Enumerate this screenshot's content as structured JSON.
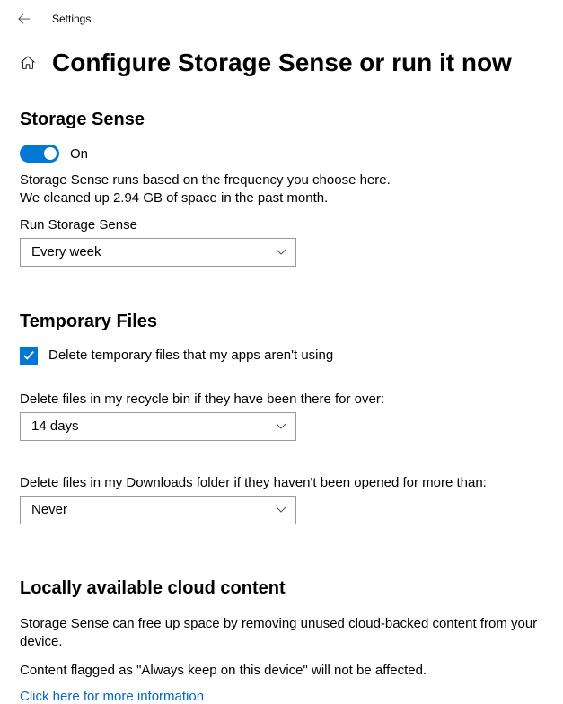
{
  "topBar": {
    "title": "Settings"
  },
  "page": {
    "title": "Configure Storage Sense or run it now"
  },
  "storageSense": {
    "sectionTitle": "Storage Sense",
    "toggleLabel": "On",
    "description": "Storage Sense runs based on the frequency you choose here. We cleaned up 2.94 GB of space in the past month.",
    "runLabel": "Run Storage Sense",
    "runValue": "Every week"
  },
  "temporaryFiles": {
    "sectionTitle": "Temporary Files",
    "checkboxLabel": "Delete temporary files that my apps aren't using",
    "recycleLabel": "Delete files in my recycle bin if they have been there for over:",
    "recycleValue": "14 days",
    "downloadsLabel": "Delete files in my Downloads folder if they haven't been opened for more than:",
    "downloadsValue": "Never"
  },
  "cloud": {
    "sectionTitle": "Locally available cloud content",
    "description1": "Storage Sense can free up space by removing unused cloud-backed content from your device.",
    "description2": "Content flagged as \"Always keep on this device\" will not be affected.",
    "linkText": "Click here for more information"
  }
}
